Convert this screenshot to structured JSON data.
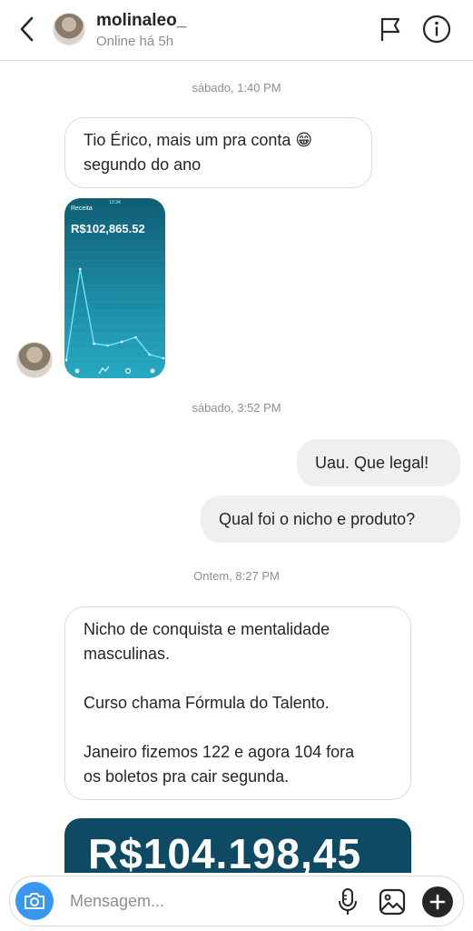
{
  "header": {
    "username": "molinaleo_",
    "status": "Online há 5h"
  },
  "messages": {
    "ts1": "sábado, 1:40 PM",
    "msg1_line1": "Tio Érico, mais um pra conta 😁",
    "msg1_line2": "segundo do ano",
    "screenshot1": {
      "title": "Receita",
      "amount": "R$102,865.52",
      "chart_values": [
        0,
        100,
        18,
        16,
        20,
        25,
        6,
        2
      ]
    },
    "ts2": "sábado, 3:52 PM",
    "out1": "Uau. Que legal!",
    "out2": "Qual foi o nicho e produto?",
    "ts3": "Ontem, 8:27 PM",
    "msg2_p1_l1": "Nicho de conquista e mentalidade",
    "msg2_p1_l2": "masculinas.",
    "msg2_p2": "Curso chama Fórmula do Talento.",
    "msg2_p3_l1": "Janeiro fizemos 122 e agora 104 fora",
    "msg2_p3_l2": "os boletos pra cair segunda.",
    "screenshot2_amount": "R$104.198,45"
  },
  "composer": {
    "placeholder": "Mensagem..."
  },
  "icons": {
    "back": "chevron-left-icon",
    "flag": "flag-icon",
    "info": "info-icon",
    "camera": "camera-icon",
    "mic": "microphone-icon",
    "gallery": "gallery-icon",
    "plus": "plus-icon"
  },
  "colors": {
    "accent": "#3897f0",
    "incoming_border": "#dbdbdb",
    "outgoing_bg": "#efefef",
    "muted": "#8e8e8e"
  }
}
